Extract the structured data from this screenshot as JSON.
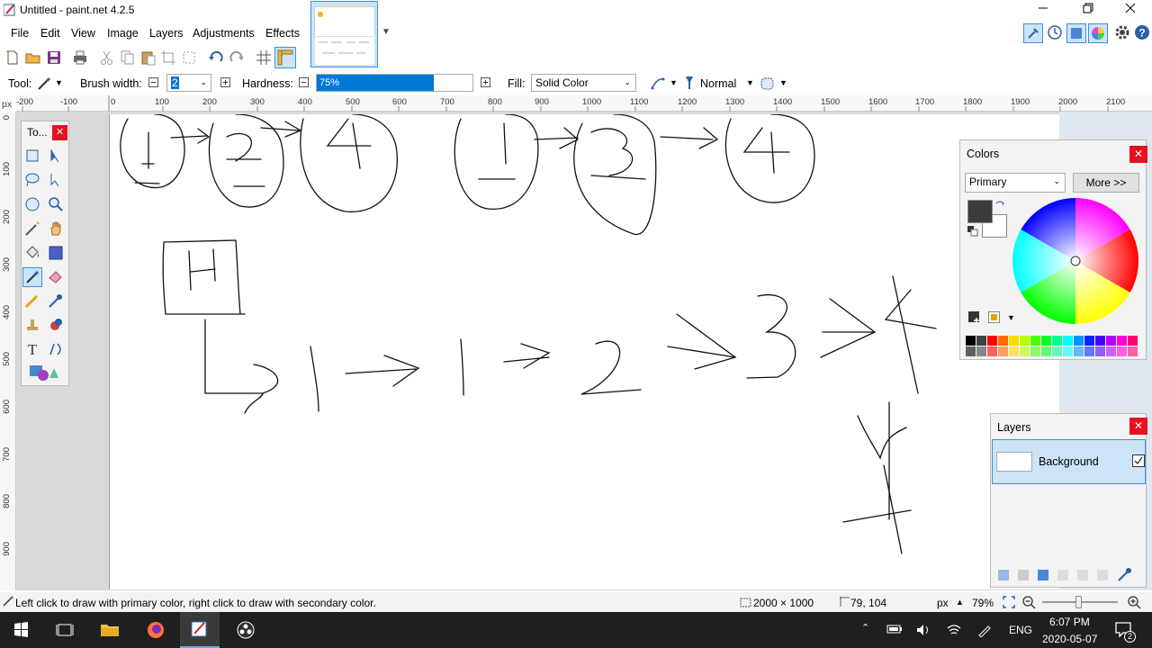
{
  "window": {
    "title": "Untitled - paint.net 4.2.5",
    "minimize_icon": "minimize-icon",
    "restore_icon": "restore-icon",
    "close_icon": "close-icon"
  },
  "menu": {
    "items": [
      "File",
      "Edit",
      "View",
      "Image",
      "Layers",
      "Adjustments",
      "Effects"
    ]
  },
  "tool_options": {
    "tool_label": "Tool:",
    "brush_width_label": "Brush width:",
    "brush_width_value": "2",
    "hardness_label": "Hardness:",
    "hardness_value": "75%",
    "hardness_fraction": 0.75,
    "fill_label": "Fill:",
    "fill_value": "Solid Color",
    "blend_mode": "Normal"
  },
  "ruler": {
    "unit": "px",
    "h_ticks": [
      "-200",
      "-100",
      "0",
      "100",
      "200",
      "300",
      "400",
      "500",
      "600",
      "700",
      "800",
      "900",
      "1000",
      "1100",
      "1200",
      "1300",
      "1400",
      "1500",
      "1600",
      "1700",
      "1800",
      "1900",
      "2000",
      "2100"
    ],
    "v_ticks": [
      "0",
      "100",
      "200",
      "300",
      "400",
      "500",
      "600",
      "700",
      "800",
      "900"
    ]
  },
  "tools_window": {
    "title": "To...",
    "close_icon": "close-icon"
  },
  "colors_window": {
    "title": "Colors",
    "mode": "Primary",
    "more_button": "More >>",
    "primary_color": "#3c3c3c",
    "secondary_color": "#ffffff",
    "palette": [
      "#000000",
      "#404040",
      "#ff0000",
      "#ff6a00",
      "#ffd800",
      "#b6ff00",
      "#4cff00",
      "#00ff21",
      "#00ff90",
      "#00ffff",
      "#0094ff",
      "#0026ff",
      "#4800ff",
      "#b200ff",
      "#ff00dc",
      "#ff006e"
    ]
  },
  "layers_window": {
    "title": "Layers",
    "layers": [
      {
        "name": "Background",
        "visible": true
      }
    ]
  },
  "status": {
    "hint": "Left click to draw with primary color, right click to draw with secondary color.",
    "image_size": "2000 × 1000",
    "cursor_pos": "79, 104",
    "unit": "px",
    "zoom": "79%"
  },
  "taskbar": {
    "language": "ENG",
    "time": "6:07 PM",
    "date": "2020-05-07",
    "notification_count": "2"
  },
  "colors": {
    "accent": "#0078d7",
    "selection": "#cce4f7",
    "close_red": "#e81123"
  }
}
